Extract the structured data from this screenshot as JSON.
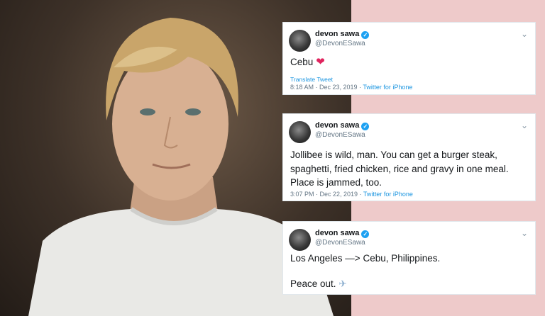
{
  "photo": {
    "description_icon": "person-portrait"
  },
  "tweets": [
    {
      "name": "devon sawa",
      "handle": "@DevonESawa",
      "text": "Cebu",
      "emoji": "❤",
      "translate": "Translate Tweet",
      "time": "8:18 AM · Dec 23, 2019 · ",
      "source": "Twitter for iPhone"
    },
    {
      "name": "devon sawa",
      "handle": "@DevonESawa",
      "text": "Jollibee is wild, man. You can get a burger steak, spaghetti, fried chicken, rice and gravy in one meal. Place is jammed, too.",
      "time": "3:07 PM · Dec 22, 2019 · ",
      "source": "Twitter for iPhone"
    },
    {
      "name": "devon sawa",
      "handle": "@DevonESawa",
      "line1": "Los Angeles —> Cebu, Philippines.",
      "line2": "Peace out.",
      "emoji": "✈"
    }
  ],
  "icons": {
    "verified": "verified-badge-icon",
    "chevron": "chevron-down-icon"
  },
  "colors": {
    "pink_bg": "#eecaca",
    "link": "#1b95e0",
    "heart": "#e0245e"
  }
}
